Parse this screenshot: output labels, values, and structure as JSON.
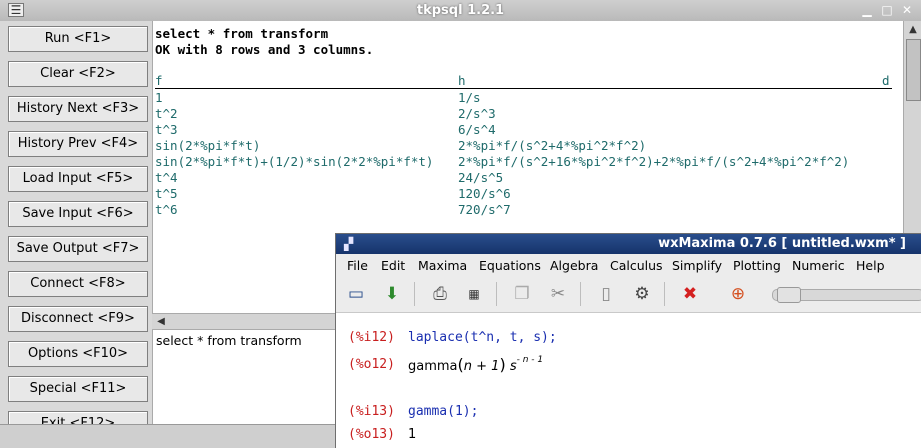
{
  "tkpsql": {
    "title": "tkpsql 1.2.1",
    "buttons": [
      {
        "label": "Run <F1>"
      },
      {
        "label": "Clear <F2>"
      },
      {
        "label": "History Next <F3>"
      },
      {
        "label": "History Prev <F4>"
      },
      {
        "label": "Load Input <F5>"
      },
      {
        "label": "Save Input <F6>"
      },
      {
        "label": "Save Output <F7>"
      },
      {
        "label": "Connect <F8>"
      },
      {
        "label": "Disconnect <F9>"
      },
      {
        "label": "Options <F10>"
      },
      {
        "label": "Special <F11>"
      },
      {
        "label": "Exit <F12>"
      }
    ],
    "output": {
      "query": "select * from transform",
      "status": "OK with 8 rows and 3 columns.",
      "columns": [
        "f",
        "h",
        "d"
      ],
      "rows": [
        [
          "1",
          "1/s"
        ],
        [
          "t^2",
          "2/s^3"
        ],
        [
          "t^3",
          "6/s^4"
        ],
        [
          "sin(2*%pi*f*t)",
          "2*%pi*f/(s^2+4*%pi^2*f^2)"
        ],
        [
          "sin(2*%pi*f*t)+(1/2)*sin(2*2*%pi*f*t)",
          "2*%pi*f/(s^2+16*%pi^2*f^2)+2*%pi*f/(s^2+4*%pi^2*f^2)"
        ],
        [
          "t^4",
          "24/s^5"
        ],
        [
          "t^5",
          "120/s^6"
        ],
        [
          "t^6",
          "720/s^7"
        ]
      ]
    },
    "input_text": "select * from transform"
  },
  "wxmaxima": {
    "title": "wxMaxima 0.7.6  [ untitled.wxm* ]",
    "menu": [
      "File",
      "Edit",
      "Maxima",
      "Equations",
      "Algebra",
      "Calculus",
      "Simplify",
      "Plotting",
      "Numeric",
      "Help"
    ],
    "toolbar_icons": [
      "new-icon",
      "open-icon",
      "print-icon",
      "options-icon",
      "copy-icon",
      "cut-icon",
      "select-all-icon",
      "preferences-icon",
      "interrupt-icon",
      "help-icon"
    ],
    "cells": {
      "in1_label": "(%i12)",
      "in1_code": "laplace(t^n, t, s);",
      "out1_label": "(%o12)",
      "out1_fn": "gamma",
      "out1_arg": "n + 1",
      "out1_base": "s",
      "out1_exp": "- n - 1",
      "in2_label": "(%i13)",
      "in2_code": "gamma(1);",
      "out2_label": "(%o13)",
      "out2_value": "1"
    }
  }
}
